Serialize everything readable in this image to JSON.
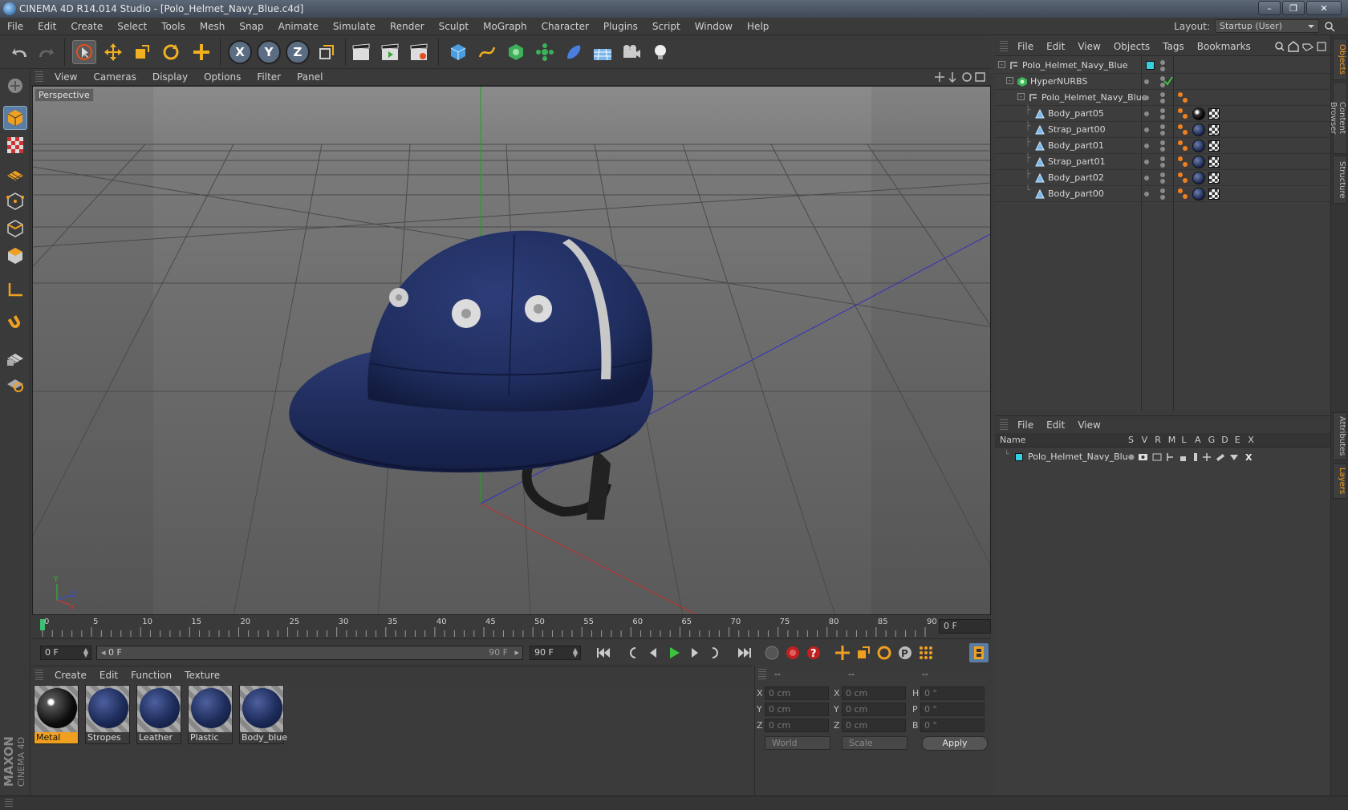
{
  "window": {
    "title": "CINEMA 4D R14.014 Studio - [Polo_Helmet_Navy_Blue.c4d]"
  },
  "menu": [
    "File",
    "Edit",
    "Create",
    "Select",
    "Tools",
    "Mesh",
    "Snap",
    "Animate",
    "Simulate",
    "Render",
    "Sculpt",
    "MoGraph",
    "Character",
    "Plugins",
    "Script",
    "Window",
    "Help"
  ],
  "layout": {
    "label": "Layout:",
    "value": "Startup (User)"
  },
  "viewport": {
    "menu": [
      "View",
      "Cameras",
      "Display",
      "Options",
      "Filter",
      "Panel"
    ],
    "label": "Perspective"
  },
  "timeline": {
    "ticks": [
      "0",
      "5",
      "10",
      "15",
      "20",
      "25",
      "30",
      "35",
      "40",
      "45",
      "50",
      "55",
      "60",
      "65",
      "70",
      "75",
      "80",
      "85",
      "90"
    ],
    "frame_end": "0 F",
    "current": "0 F",
    "range_start": "0 F",
    "range_end": "90 F",
    "max": "90 F"
  },
  "materials": {
    "menu": [
      "Create",
      "Edit",
      "Function",
      "Texture"
    ],
    "items": [
      {
        "name": "Metal",
        "color": "#0c0c0c"
      },
      {
        "name": "Stropes",
        "color": "#1d2c5a"
      },
      {
        "name": "Leather",
        "color": "#1d2c5a"
      },
      {
        "name": "Plastic",
        "color": "#1d2c5a"
      },
      {
        "name": "Body_blue",
        "color": "#1d2c5a"
      }
    ]
  },
  "coordinates": {
    "headers": [
      "--",
      "--",
      "--"
    ],
    "rows": [
      {
        "a": "X",
        "av": "0 cm",
        "b": "X",
        "bv": "0 cm",
        "c": "H",
        "cv": "0 °"
      },
      {
        "a": "Y",
        "av": "0 cm",
        "b": "Y",
        "bv": "0 cm",
        "c": "P",
        "cv": "0 °"
      },
      {
        "a": "Z",
        "av": "0 cm",
        "b": "Z",
        "bv": "0 cm",
        "c": "B",
        "cv": "0 °"
      }
    ],
    "mode1": "World",
    "mode2": "Scale",
    "apply": "Apply"
  },
  "objects": {
    "menu": [
      "File",
      "Edit",
      "View",
      "Objects",
      "Tags",
      "Bookmarks"
    ],
    "tree": [
      {
        "name": "Polo_Helmet_Navy_Blue",
        "level": 0,
        "type": "null"
      },
      {
        "name": "HyperNURBS",
        "level": 1,
        "type": "nurbs"
      },
      {
        "name": "Polo_Helmet_Navy_Blue",
        "level": 2,
        "type": "null"
      },
      {
        "name": "Body_part05",
        "level": 3,
        "type": "poly"
      },
      {
        "name": "Strap_part00",
        "level": 3,
        "type": "poly"
      },
      {
        "name": "Body_part01",
        "level": 3,
        "type": "poly"
      },
      {
        "name": "Strap_part01",
        "level": 3,
        "type": "poly"
      },
      {
        "name": "Body_part02",
        "level": 3,
        "type": "poly"
      },
      {
        "name": "Body_part00",
        "level": 3,
        "type": "poly"
      }
    ]
  },
  "layers": {
    "menu": [
      "File",
      "Edit",
      "View"
    ],
    "header": {
      "name": "Name",
      "cols": [
        "S",
        "V",
        "R",
        "M",
        "L",
        "A",
        "G",
        "D",
        "E",
        "X"
      ]
    },
    "items": [
      {
        "name": "Polo_Helmet_Navy_Blue",
        "color": "#34d0e0"
      }
    ]
  },
  "side_tabs": [
    "Objects",
    "Content Browser",
    "Structure",
    "Attributes",
    "Layers"
  ],
  "brand": {
    "line1": "MAXON",
    "line2": "CINEMA 4D"
  },
  "colors": {
    "accent": "#f0a020",
    "helmet": "#1f2d5e",
    "layer_color": "#34d0e0"
  }
}
